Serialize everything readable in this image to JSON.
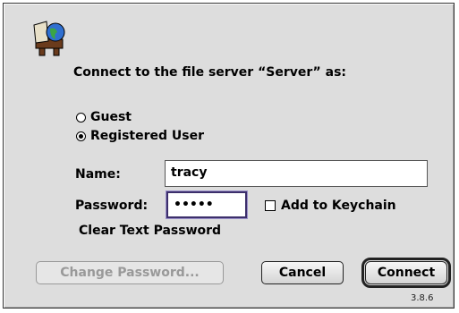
{
  "dialog": {
    "prompt": "Connect to the file server “Server” as:",
    "login_options": [
      {
        "label": "Guest",
        "selected": false
      },
      {
        "label": "Registered User",
        "selected": true
      }
    ],
    "name_label": "Name:",
    "name_value": "tracy",
    "password_label": "Password:",
    "password_value": "•••••",
    "add_to_keychain_label": "Add to Keychain",
    "add_to_keychain_checked": false,
    "clear_text_note": "Clear Text Password",
    "buttons": {
      "change_password": "Change Password...",
      "cancel": "Cancel",
      "connect": "Connect"
    },
    "version": "3.8.6"
  }
}
